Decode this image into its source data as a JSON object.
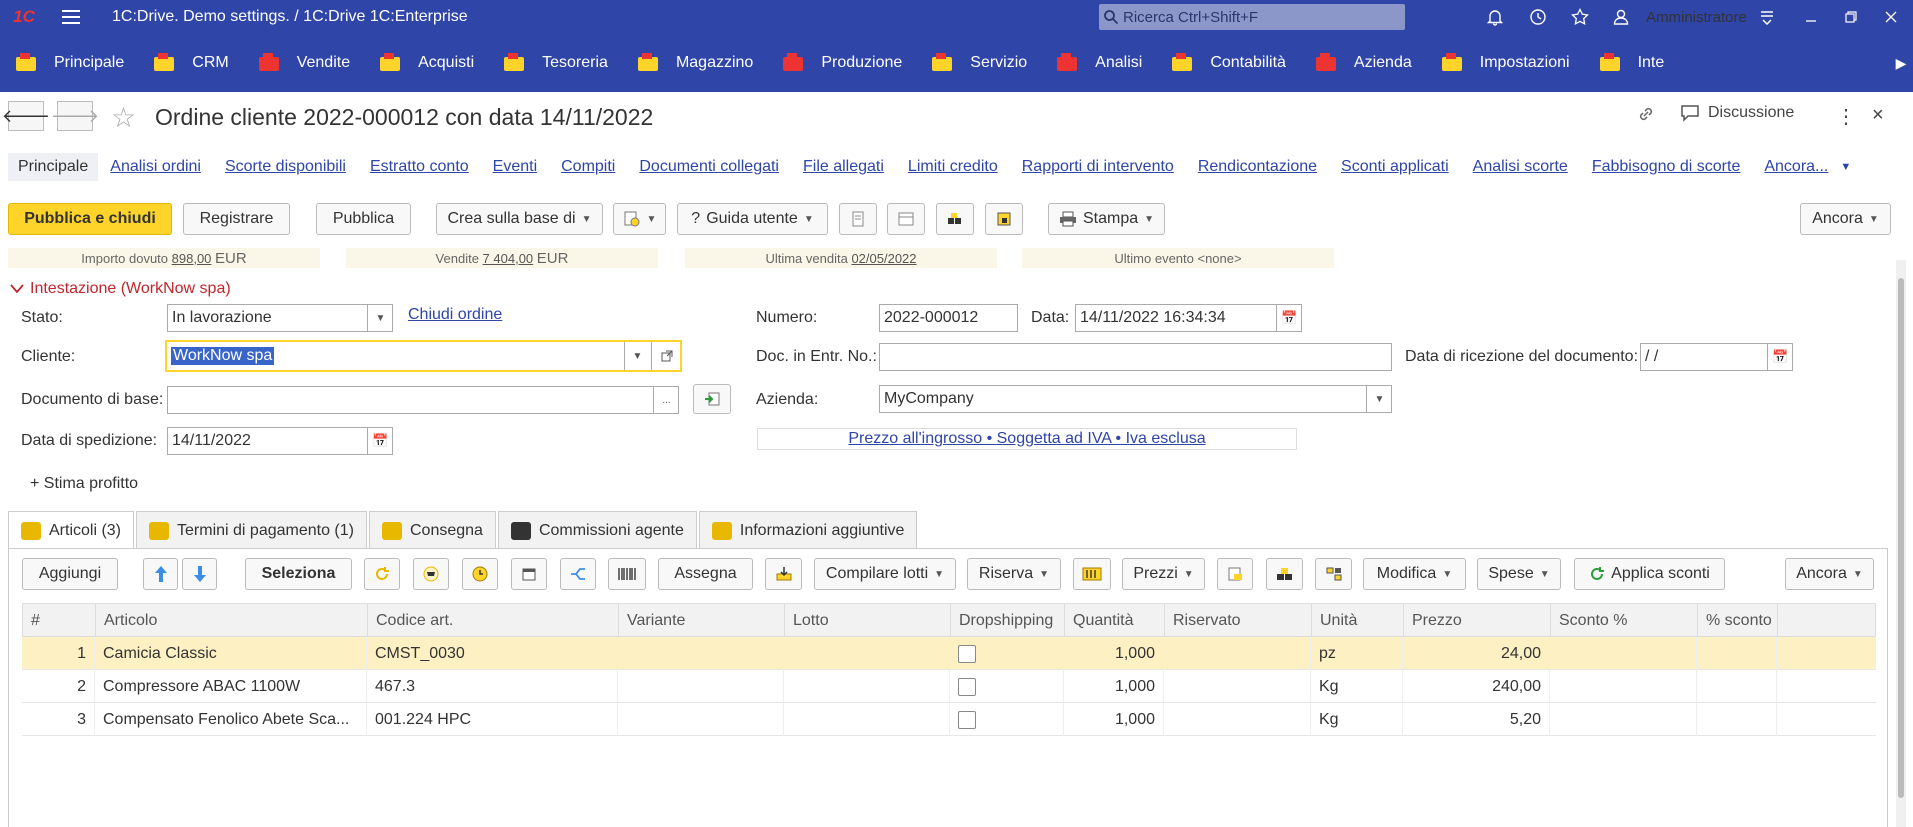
{
  "titlebar": {
    "logo": "1C",
    "title": "1C:Drive. Demo settings. / 1C:Drive 1C:Enterprise",
    "search_placeholder": "Ricerca Ctrl+Shift+F",
    "user": "Amministratore"
  },
  "sections": [
    {
      "label": "Principale",
      "icon": "home-icon"
    },
    {
      "label": "CRM",
      "icon": "crm-icon"
    },
    {
      "label": "Vendite",
      "icon": "sales-icon"
    },
    {
      "label": "Acquisti",
      "icon": "truck-icon"
    },
    {
      "label": "Tesoreria",
      "icon": "treasury-icon"
    },
    {
      "label": "Magazzino",
      "icon": "box-icon"
    },
    {
      "label": "Produzione",
      "icon": "factory-icon"
    },
    {
      "label": "Servizio",
      "icon": "service-icon"
    },
    {
      "label": "Analisi",
      "icon": "chart-icon"
    },
    {
      "label": "Contabilità",
      "icon": "accounting-icon"
    },
    {
      "label": "Azienda",
      "icon": "company-icon"
    },
    {
      "label": "Impostazioni",
      "icon": "settings-icon"
    },
    {
      "label": "Inte",
      "icon": "cloud-icon"
    }
  ],
  "form": {
    "title": "Ordine cliente 2022-000012 con data 14/11/2022",
    "discussion": "Discussione"
  },
  "links": [
    "Principale",
    "Analisi ordini",
    "Scorte disponibili",
    "Estratto conto",
    "Eventi",
    "Compiti",
    "Documenti collegati",
    "File allegati",
    "Limiti credito",
    "Rapporti di intervento",
    "Rendicontazione",
    "Sconti applicati",
    "Analisi scorte",
    "Fabbisogno di scorte",
    "Ancora..."
  ],
  "commands": {
    "publish_close": "Pubblica e chiudi",
    "register": "Registrare",
    "publish": "Pubblica",
    "create_based": "Crea sulla base di",
    "guide": "Guida utente",
    "print": "Stampa",
    "more": "Ancora"
  },
  "info": {
    "due_label": "Importo dovuto",
    "due_value": "898,00",
    "due_currency": "EUR",
    "sales_label": "Vendite",
    "sales_value": "7 404,00",
    "sales_currency": "EUR",
    "last_sale_label": "Ultima vendita",
    "last_sale_value": "02/05/2022",
    "last_event": "Ultimo evento <none>"
  },
  "header_group": {
    "title": "Intestazione (WorkNow spa)",
    "status_label": "Stato:",
    "status_value": "In lavorazione",
    "close_order": "Chiudi ordine",
    "customer_label": "Cliente:",
    "customer_value": "WorkNow spa",
    "base_doc_label": "Documento di base:",
    "base_doc_value": "",
    "ship_date_label": "Data di spedizione:",
    "ship_date_value": "14/11/2022",
    "number_label": "Numero:",
    "number_value": "2022-000012",
    "date_label": "Data:",
    "date_value": "14/11/2022 16:34:34",
    "incoming_doc_label": "Doc. in Entr. No.:",
    "incoming_doc_value": "",
    "receipt_date_label": "Data di ricezione del documento:",
    "receipt_date_value": " /  /",
    "company_label": "Azienda:",
    "company_value": "MyCompany",
    "price_terms": "Prezzo all'ingrosso • Soggetta ad IVA • Iva esclusa",
    "profit_estimate": "+ Stima profitto"
  },
  "page_tabs": [
    {
      "label": "Articoli (3)",
      "color": "#e8b800"
    },
    {
      "label": "Termini di pagamento (1)",
      "color": "#e8b800"
    },
    {
      "label": "Consegna",
      "color": "#e8b800"
    },
    {
      "label": "Commissioni agente",
      "color": "#333333"
    },
    {
      "label": "Informazioni aggiuntive",
      "color": "#e8b800"
    }
  ],
  "table_toolbar": {
    "add": "Aggiungi",
    "select": "Seleziona",
    "assign": "Assegna",
    "fill_lots": "Compilare lotti",
    "reserve": "Riserva",
    "prices": "Prezzi",
    "modify": "Modifica",
    "expenses": "Spese",
    "apply_discounts": "Applica sconti",
    "more": "Ancora"
  },
  "columns": [
    "#",
    "Articolo",
    "Codice art.",
    "Variante",
    "Lotto",
    "Dropshipping",
    "Quantità",
    "Riservato",
    "Unità",
    "Prezzo",
    "Sconto %",
    "% sconto a"
  ],
  "rows": [
    {
      "n": "1",
      "item": "Camicia Classic",
      "code": "CMST_0030",
      "variant": "",
      "lot": "",
      "qty": "1,000",
      "reserved": "",
      "unit": "pz",
      "price": "24,00",
      "discount": "",
      "discount2": ""
    },
    {
      "n": "2",
      "item": "Compressore ABAC 1100W",
      "code": "467.3",
      "variant": "",
      "lot": "",
      "qty": "1,000",
      "reserved": "",
      "unit": "Kg",
      "price": "240,00",
      "discount": "",
      "discount2": ""
    },
    {
      "n": "3",
      "item": "Compensato Fenolico Abete Sca...",
      "code": "001.224 HPC",
      "variant": "",
      "lot": "",
      "qty": "1,000",
      "reserved": "",
      "unit": "Kg",
      "price": "5,20",
      "discount": "",
      "discount2": ""
    }
  ],
  "colors": {
    "brand": "#2f45a8",
    "accent": "#ffd42a",
    "group_title": "#c0262d",
    "selected_row": "#fdf0c3"
  }
}
